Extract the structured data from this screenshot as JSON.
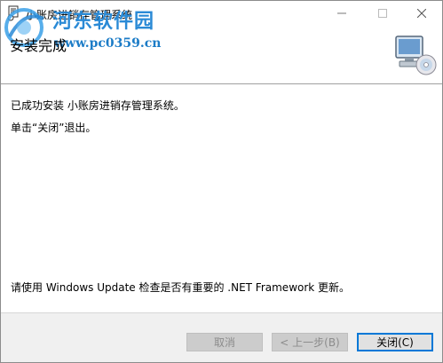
{
  "window": {
    "title": "小账房进销存管理系统",
    "controls": {
      "minimize": "—",
      "maximize": "☐",
      "close": "✕"
    }
  },
  "watermark": {
    "name": "河东软件园",
    "url": "www.pc0359.cn"
  },
  "header": {
    "title": "安装完成"
  },
  "body": {
    "line1": "已成功安装 小账房进销存管理系统。",
    "line2": "单击“关闭”退出。",
    "line3": "请使用 Windows Update 检查是否有重要的 .NET Framework 更新。"
  },
  "footer": {
    "cancel_label": "取消",
    "back_label": "< 上一步(B)",
    "close_label": "关闭(C)"
  },
  "colors": {
    "accent": "#0078d7",
    "watermark_blue": "#2a8ad6",
    "footer_bg": "#f0f0f0"
  }
}
